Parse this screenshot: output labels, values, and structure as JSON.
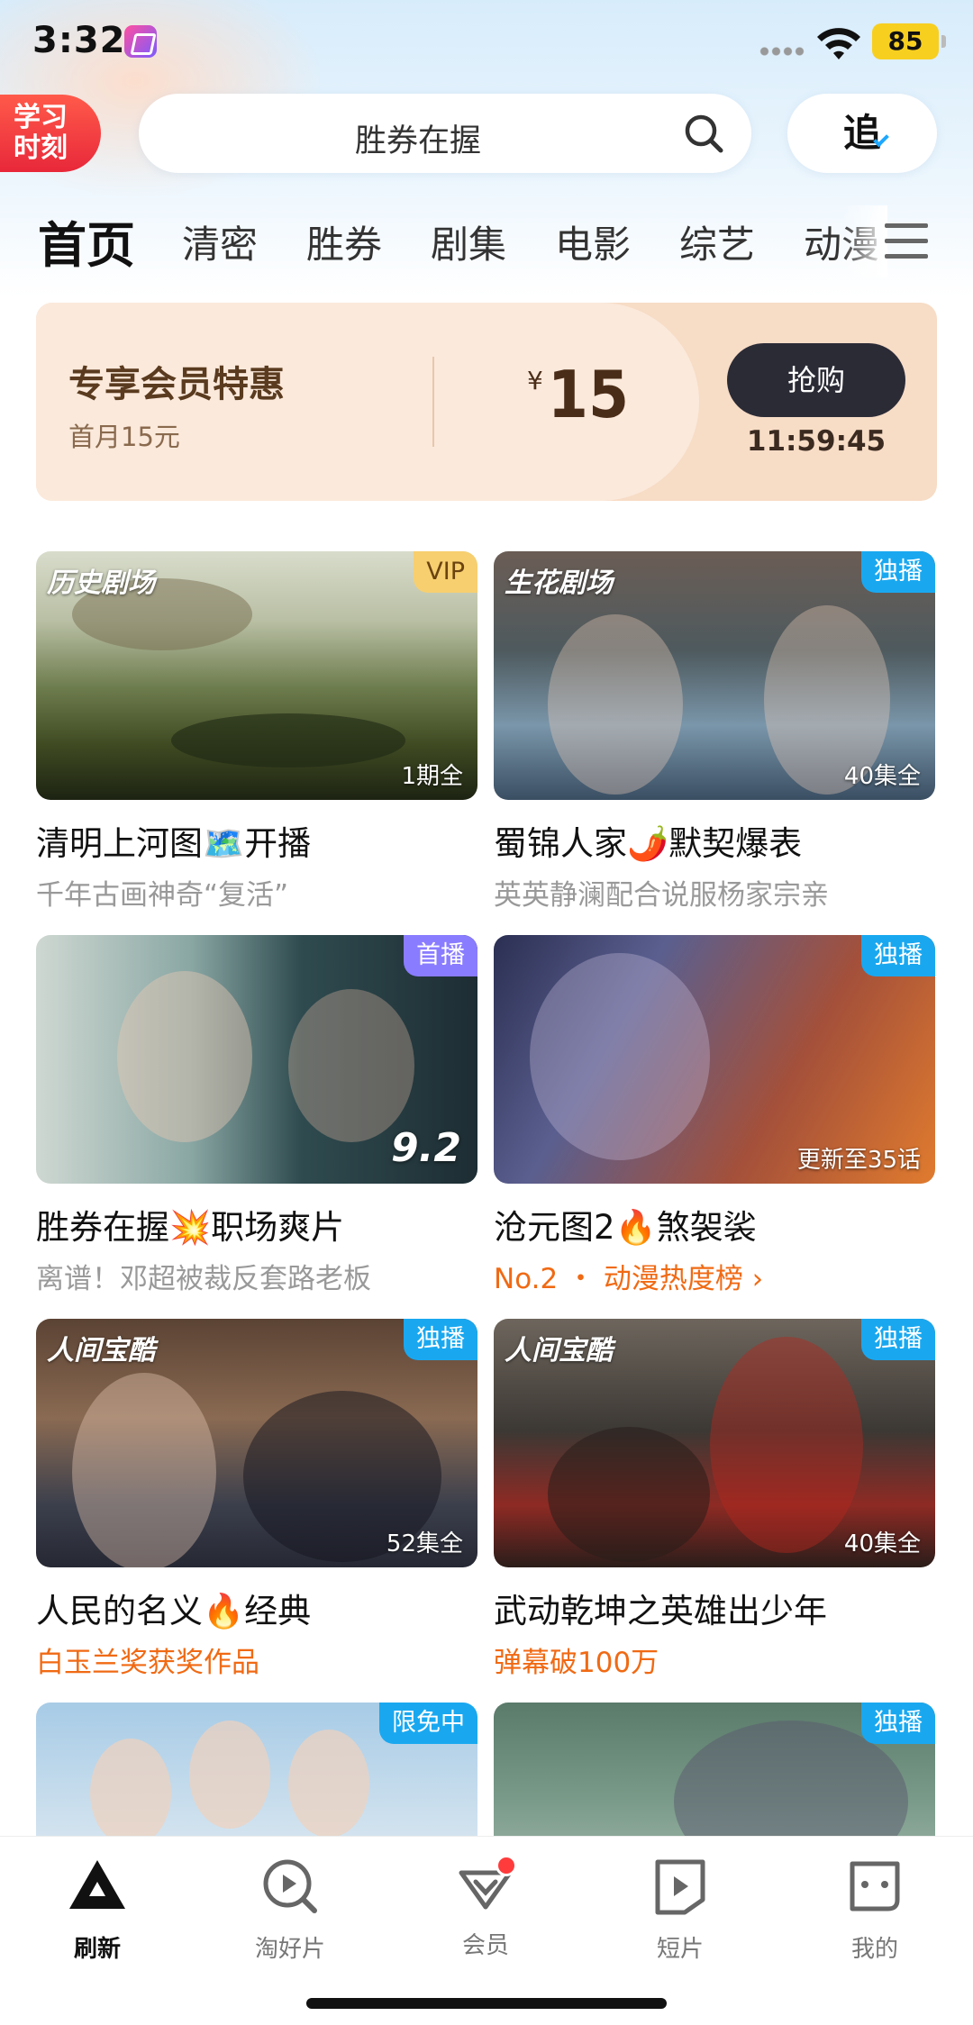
{
  "status": {
    "time": "3:32",
    "battery": "85"
  },
  "header": {
    "study_line1": "学习",
    "study_line2": "时刻",
    "search_text": "胜券在握",
    "follow_label": "追"
  },
  "tabs": [
    "首页",
    "清密",
    "胜券",
    "剧集",
    "电影",
    "综艺",
    "动漫"
  ],
  "promo": {
    "title": "专享会员特惠",
    "subtitle": "首月15元",
    "currency": "¥",
    "price": "15",
    "button": "抢购",
    "countdown": "11:59:45"
  },
  "cards": [
    {
      "badge": "VIP",
      "overlay": "1期全",
      "logo": "历史剧场",
      "title": "清明上河图🗺️开播",
      "sub": "千年古画神奇“复活”",
      "sub_hot": false
    },
    {
      "badge": "独播",
      "overlay": "40集全",
      "logo": "生花剧场",
      "title": "蜀锦人家🌶️默契爆表",
      "sub": "英英静澜配合说服杨家宗亲",
      "sub_hot": false
    },
    {
      "badge": "首播",
      "overlay": "9.2",
      "logo": "",
      "title": "胜券在握💥职场爽片",
      "sub": "离谱！邓超被裁反套路老板",
      "sub_hot": false
    },
    {
      "badge": "独播",
      "overlay": "更新至35话",
      "logo": "",
      "title": "沧元图2🔥煞袈裟",
      "sub": "No.2 ・ 动漫热度榜 ›",
      "sub_hot": true
    },
    {
      "badge": "独播",
      "overlay": "52集全",
      "logo": "人间宝酷",
      "title": "人民的名义🔥经典",
      "sub": "白玉兰奖获奖作品",
      "sub_hot": true
    },
    {
      "badge": "独播",
      "overlay": "40集全",
      "logo": "人间宝酷",
      "title": "武动乾坤之英雄出少年",
      "sub": "弹幕破100万",
      "sub_hot": true
    },
    {
      "badge": "限免中",
      "overlay": "",
      "logo": "",
      "title": "",
      "sub": "",
      "sub_hot": false
    },
    {
      "badge": "独播",
      "overlay": "",
      "logo": "",
      "title": "",
      "sub": "",
      "sub_hot": false
    }
  ],
  "bottom_nav": [
    {
      "label": "刷新",
      "icon": "home-triangle-icon"
    },
    {
      "label": "淘好片",
      "icon": "discover-play-icon"
    },
    {
      "label": "会员",
      "icon": "vip-diamond-icon"
    },
    {
      "label": "短片",
      "icon": "short-video-icon"
    },
    {
      "label": "我的",
      "icon": "profile-face-icon"
    }
  ]
}
